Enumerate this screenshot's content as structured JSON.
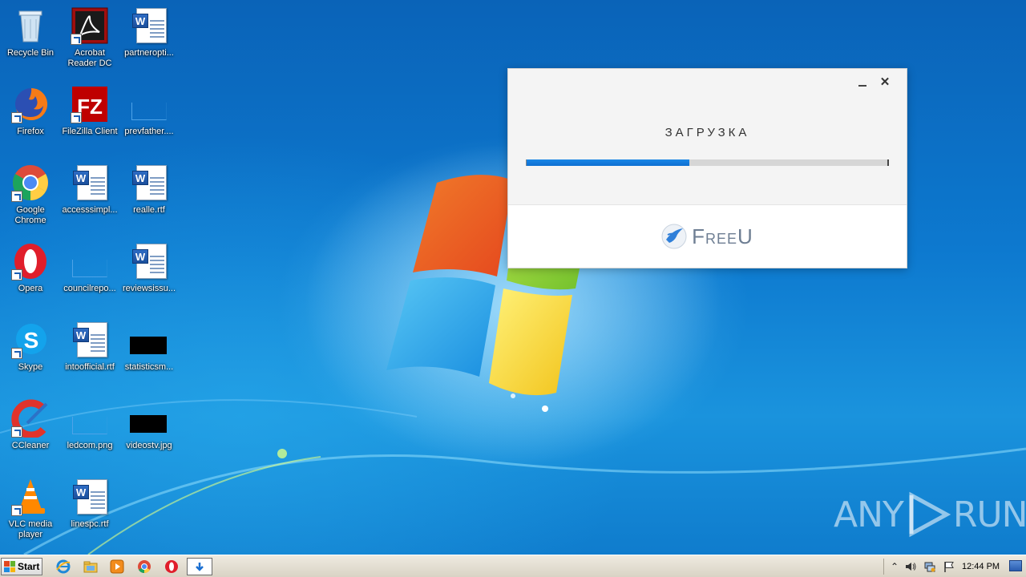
{
  "desktop": {
    "icons": [
      {
        "label": "Recycle Bin",
        "icon": "recycle-bin-icon"
      },
      {
        "label": "Acrobat Reader DC",
        "icon": "acrobat-reader-icon"
      },
      {
        "label": "partneropti...",
        "icon": "word-document-icon"
      },
      {
        "label": "Firefox",
        "icon": "firefox-icon"
      },
      {
        "label": "FileZilla Client",
        "icon": "filezilla-icon"
      },
      {
        "label": "prevfather....",
        "icon": "image-file-icon"
      },
      {
        "label": "Google Chrome",
        "icon": "chrome-icon"
      },
      {
        "label": "accesssimpl...",
        "icon": "word-document-icon"
      },
      {
        "label": "realle.rtf",
        "icon": "word-document-icon"
      },
      {
        "label": "Opera",
        "icon": "opera-icon"
      },
      {
        "label": "councilrepo...",
        "icon": "image-file-icon"
      },
      {
        "label": "reviewsissu...",
        "icon": "word-document-icon"
      },
      {
        "label": "Skype",
        "icon": "skype-icon"
      },
      {
        "label": "intoofficial.rtf",
        "icon": "word-document-icon"
      },
      {
        "label": "statisticsm...",
        "icon": "image-thumbnail-icon"
      },
      {
        "label": "CCleaner",
        "icon": "ccleaner-icon"
      },
      {
        "label": "ledcom.png",
        "icon": "image-file-icon"
      },
      {
        "label": "videostv.jpg",
        "icon": "image-thumbnail-icon"
      },
      {
        "label": "VLC media player",
        "icon": "vlc-icon"
      },
      {
        "label": "linespc.rtf",
        "icon": "word-document-icon"
      }
    ]
  },
  "dialog": {
    "title": "ЗАГРУЗКА",
    "progress": 0.45,
    "brand": "FreeU",
    "minimize_icon": "minimize-icon",
    "close_icon": "close-icon",
    "accent_color": "#1a86e6"
  },
  "watermark": {
    "left": "ANY",
    "right": "RUN"
  },
  "taskbar": {
    "start_label": "Start",
    "clock": "12:44 PM",
    "pinned": [
      "internet-explorer-icon",
      "explorer-icon",
      "media-player-icon",
      "chrome-icon",
      "opera-icon",
      "download-icon"
    ],
    "tray": [
      "chevron-up-icon",
      "volume-icon",
      "network-icon",
      "flag-icon"
    ]
  }
}
